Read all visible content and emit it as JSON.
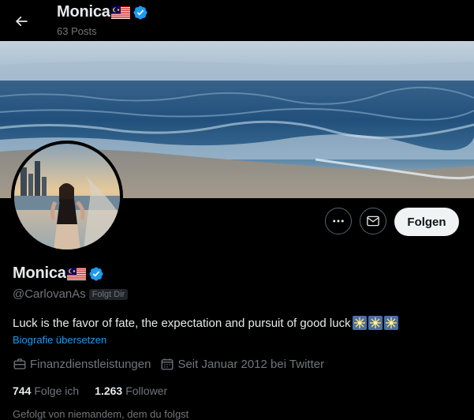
{
  "header": {
    "back_icon": "arrow-left-icon",
    "name": "Monica",
    "flag_icon": "malaysia-flag-icon",
    "verified_icon": "verified-badge-icon",
    "posts": "63 Posts"
  },
  "profile": {
    "name": "Monica",
    "handle": "@CarlovanAs",
    "follows_you": "Folgt Dir",
    "bio": "Luck is the favor of fate, the expectation and pursuit of good luck",
    "bio_emoji": "sparkle-firework-icon",
    "translate_bio": "Biografie übersetzen",
    "category": "Finanzdienstleistungen",
    "joined": "Seit Januar 2012 bei Twitter",
    "following_count": "744",
    "following_label": "Folge ich",
    "followers_count": "1.263",
    "followers_label": "Follower",
    "followed_by": "Gefolgt von niemandem, dem du folgst"
  },
  "actions": {
    "more_icon": "more-options-icon",
    "message_icon": "envelope-icon",
    "follow_label": "Folgen"
  },
  "colors": {
    "background": "#000000",
    "text_primary": "#e7e9ea",
    "text_secondary": "#71767b",
    "accent": "#1d9bf0",
    "follow_button_bg": "#eff3f4"
  }
}
